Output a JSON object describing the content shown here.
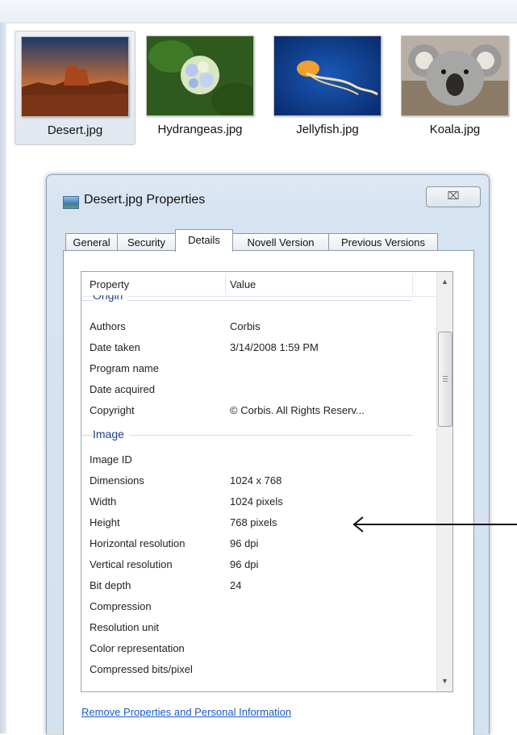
{
  "explorer": {
    "files": [
      {
        "name": "Desert.jpg",
        "selected": true
      },
      {
        "name": "Hydrangeas.jpg",
        "selected": false
      },
      {
        "name": "Jellyfish.jpg",
        "selected": false
      },
      {
        "name": "Koala.jpg",
        "selected": false
      }
    ]
  },
  "dialog": {
    "title": "Desert.jpg Properties",
    "close_glyph": "⌧",
    "tabs": [
      "General",
      "Security",
      "Details",
      "Novell Version",
      "Previous Versions"
    ],
    "active_tab": "Details",
    "columns": {
      "property": "Property",
      "value": "Value"
    },
    "groups": {
      "origin": "Origin",
      "image": "Image"
    },
    "origin_rows": [
      {
        "property": "Authors",
        "value": "Corbis"
      },
      {
        "property": "Date taken",
        "value": "3/14/2008 1:59 PM"
      },
      {
        "property": "Program name",
        "value": ""
      },
      {
        "property": "Date acquired",
        "value": ""
      },
      {
        "property": "Copyright",
        "value": "© Corbis.  All Rights Reserv..."
      }
    ],
    "image_rows": [
      {
        "property": "Image ID",
        "value": ""
      },
      {
        "property": "Dimensions",
        "value": "1024 x 768"
      },
      {
        "property": "Width",
        "value": "1024 pixels"
      },
      {
        "property": "Height",
        "value": "768 pixels"
      },
      {
        "property": "Horizontal resolution",
        "value": "96 dpi"
      },
      {
        "property": "Vertical resolution",
        "value": "96 dpi"
      },
      {
        "property": "Bit depth",
        "value": "24"
      },
      {
        "property": "Compression",
        "value": ""
      },
      {
        "property": "Resolution unit",
        "value": ""
      },
      {
        "property": "Color representation",
        "value": ""
      },
      {
        "property": "Compressed bits/pixel",
        "value": ""
      }
    ],
    "remove_link": "Remove Properties and Personal Information"
  },
  "colors": {
    "link": "#1a5ac8",
    "group_header": "#1e3f8c",
    "dialog_frame": "#d4e2f0"
  }
}
